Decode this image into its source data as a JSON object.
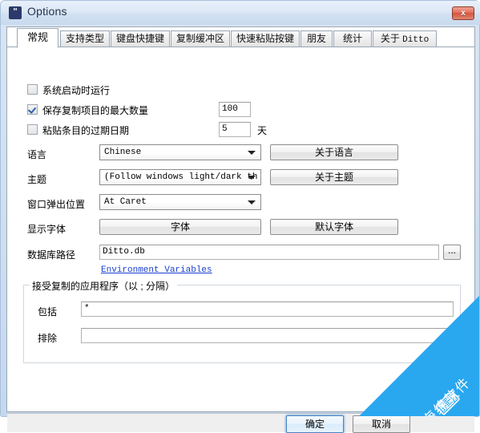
{
  "window": {
    "title": "Options",
    "icon": "ditto-quote-icon",
    "close_label": "✕",
    "close_glyph": "x",
    "icon_glyph": "\"",
    "accent_color": "#29a7ef",
    "titlebar_color": "#d2e0f2",
    "default_button_border": "#4b85c4"
  },
  "tabs": [
    {
      "label": "常规",
      "selected": true
    },
    {
      "label": "支持类型",
      "selected": false
    },
    {
      "label": "键盘快捷键",
      "selected": false
    },
    {
      "label": "复制缓冲区",
      "selected": false
    },
    {
      "label": "快速粘贴按键",
      "selected": false
    },
    {
      "label": "朋友",
      "selected": false
    },
    {
      "label": "统计",
      "selected": false
    },
    {
      "label": "关于 Ditto",
      "selected": false,
      "label_main": "关于",
      "label_mono": "Ditto"
    }
  ],
  "general": {
    "checkboxes": [
      {
        "label": "系统启动时运行",
        "checked": false
      },
      {
        "label": "保存复制项目的最大数量",
        "checked": true
      },
      {
        "label": "粘贴条目的过期日期",
        "checked": false
      }
    ],
    "max_copy_count": "100",
    "expire_days": "5",
    "expire_days_unit": "天",
    "language_label": "语言",
    "language_value": "Chinese",
    "language_about_button": "关于语言",
    "theme_label": "主题",
    "theme_value": "(Follow windows light/dark th",
    "theme_about_button": "关于主题",
    "popup_position_label": "窗口弹出位置",
    "popup_position_value": "At Caret",
    "display_font_label": "显示字体",
    "font_button": "字体",
    "default_font_button": "默认字体",
    "db_path_label": "数据库路径",
    "db_path_value": "Ditto.db",
    "db_browse_button": "...",
    "env_vars_link": "Environment Variables",
    "group_title": "接受复制的应用程序（以 ; 分隔）",
    "include_label": "包括",
    "include_value": "*",
    "exclude_label": "排除",
    "exclude_value": ""
  },
  "footer": {
    "ok_button": "确定",
    "cancel_button": "取消",
    "hidden_button": ""
  },
  "watermark": {
    "text": "海绵软件",
    "glyph": "⌨"
  }
}
